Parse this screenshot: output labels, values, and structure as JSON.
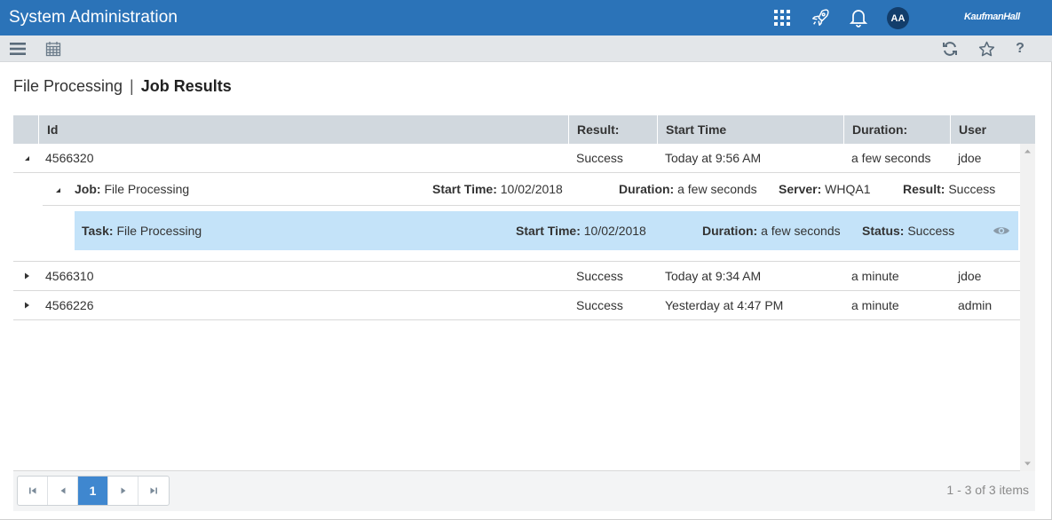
{
  "header": {
    "title": "System Administration",
    "avatar_initials": "AA",
    "brand": "KaufmanHall",
    "accent_color": "#2b73b8",
    "icons": [
      "apps-grid-icon",
      "rocket-icon",
      "bell-icon"
    ]
  },
  "toolbar": {
    "left_icons": [
      "menu-icon",
      "calendar-icon"
    ],
    "right_icons": [
      "refresh-icon",
      "star-icon",
      "help-icon"
    ]
  },
  "breadcrumb": {
    "parent": "File Processing",
    "separator": "|",
    "current": "Job Results"
  },
  "grid": {
    "columns": [
      "Id",
      "Result:",
      "Start Time",
      "Duration:",
      "User"
    ],
    "rows": [
      {
        "id": "4566320",
        "result": "Success",
        "start_time": "Today at 9:56 AM",
        "duration": "a few seconds",
        "user": "jdoe",
        "expanded": true
      },
      {
        "id": "4566310",
        "result": "Success",
        "start_time": "Today at 9:34 AM",
        "duration": "a minute",
        "user": "jdoe",
        "expanded": false
      },
      {
        "id": "4566226",
        "result": "Success",
        "start_time": "Yesterday at 4:47 PM",
        "duration": "a minute",
        "user": "admin",
        "expanded": false
      }
    ],
    "job": {
      "job_label": "Job:",
      "job_value": "File Processing",
      "start_label": "Start Time:",
      "start_value": "10/02/2018",
      "duration_label": "Duration:",
      "duration_value": "a few seconds",
      "server_label": "Server:",
      "server_value": "WHQA1",
      "result_label": "Result:",
      "result_value": "Success"
    },
    "task": {
      "task_label": "Task:",
      "task_value": "File Processing",
      "start_label": "Start Time:",
      "start_value": "10/02/2018",
      "duration_label": "Duration:",
      "duration_value": "a few seconds",
      "status_label": "Status:",
      "status_value": "Success",
      "highlight_color": "#c4e3f9"
    }
  },
  "pager": {
    "current_page": "1",
    "info": "1 - 3 of 3 items"
  }
}
